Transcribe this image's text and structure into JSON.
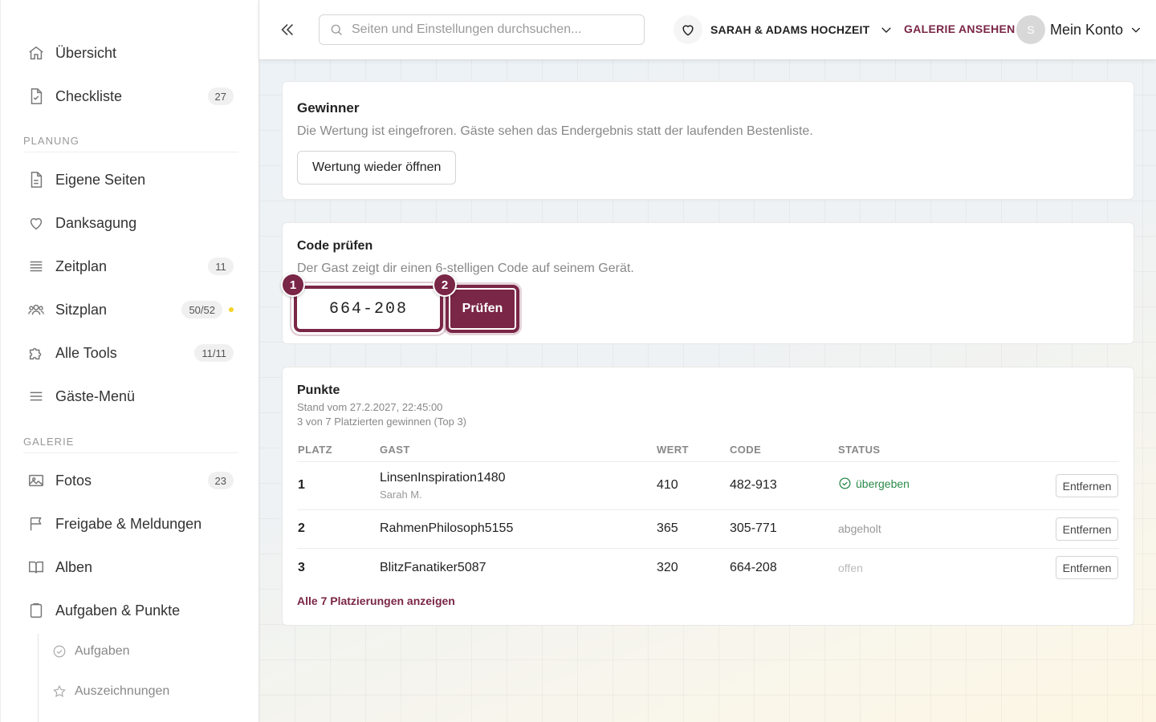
{
  "sidebar": {
    "items_top": [
      {
        "label": "Übersicht",
        "icon": "home-icon"
      },
      {
        "label": "Checkliste",
        "icon": "checklist-icon",
        "badge": "27"
      }
    ],
    "section_planning": "PLANUNG",
    "items_planning": [
      {
        "label": "Eigene Seiten",
        "icon": "page-icon"
      },
      {
        "label": "Danksagung",
        "icon": "heart-icon"
      },
      {
        "label": "Zeitplan",
        "icon": "timeline-icon",
        "badge": "11"
      },
      {
        "label": "Sitzplan",
        "icon": "people-icon",
        "badge": "50/52"
      },
      {
        "label": "Alle Tools",
        "icon": "puzzle-icon",
        "badge": "11/11"
      },
      {
        "label": "Gäste-Menü",
        "icon": "menu-icon"
      }
    ],
    "section_gallery": "GALERIE",
    "items_gallery": [
      {
        "label": "Fotos",
        "icon": "image-icon",
        "badge": "23"
      },
      {
        "label": "Freigabe & Meldungen",
        "icon": "flag-icon"
      },
      {
        "label": "Alben",
        "icon": "book-icon"
      },
      {
        "label": "Aufgaben & Punkte",
        "icon": "clipboard-icon"
      }
    ],
    "sub_items": [
      {
        "label": "Aufgaben",
        "icon": "check-circle-icon"
      },
      {
        "label": "Auszeichnungen",
        "icon": "star-icon"
      }
    ]
  },
  "topbar": {
    "search_placeholder": "Seiten und Einstellungen durchsuchen...",
    "wedding_name": "SARAH & ADAMS HOCHZEIT",
    "gallery_link": "GALERIE ANSEHEN",
    "avatar_initial": "S",
    "account_label": "Mein Konto"
  },
  "winner": {
    "title": "Gewinner",
    "description": "Die Wertung ist eingefroren. Gäste sehen das Endergebnis statt der laufenden Bestenliste.",
    "button": "Wertung wieder öffnen"
  },
  "code_check": {
    "title": "Code prüfen",
    "description": "Der Gast zeigt dir einen 6-stelligen Code auf seinem Gerät.",
    "input_value": "664-208",
    "button": "Prüfen",
    "marker_1": "1",
    "marker_2": "2"
  },
  "points": {
    "title": "Punkte",
    "timestamp": "Stand vom 27.2.2027, 22:45:00",
    "summary": "3 von 7 Platzierten gewinnen (Top 3)",
    "headers": {
      "rank": "PLATZ",
      "guest": "GAST",
      "value": "WERT",
      "code": "CODE",
      "status": "STATUS"
    },
    "rows": [
      {
        "rank": "1",
        "guest": "LinsenInspiration1480",
        "guest_sub": "Sarah M.",
        "value": "410",
        "code": "482-913",
        "status": "übergeben",
        "action": "Entfernen"
      },
      {
        "rank": "2",
        "guest": "RahmenPhilosoph5155",
        "value": "365",
        "code": "305-771",
        "status": "abgeholt",
        "action": "Entfernen"
      },
      {
        "rank": "3",
        "guest": "BlitzFanatiker5087",
        "value": "320",
        "code": "664-208",
        "status": "offen",
        "action": "Entfernen"
      }
    ],
    "show_all": "Alle 7 Platzierungen anzeigen"
  },
  "colors": {
    "accent": "#7a2646",
    "success": "#2a8a4a",
    "badge_dot": "#f2d32b"
  }
}
